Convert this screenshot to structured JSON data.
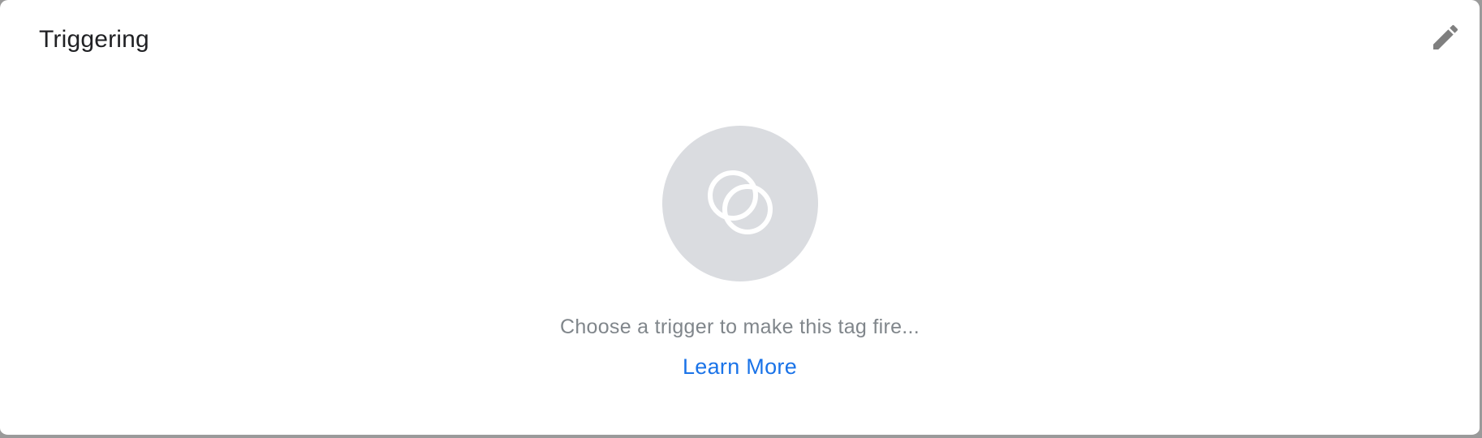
{
  "card": {
    "title": "Triggering",
    "edit_icon": "pencil-icon"
  },
  "empty_state": {
    "icon": "trigger-icon",
    "message": "Choose a trigger to make this tag fire...",
    "link_label": "Learn More"
  },
  "colors": {
    "title": "#202124",
    "message": "#80868b",
    "link": "#1a73e8",
    "icon_circle": "#dadce0",
    "icon_glyph": "#ffffff",
    "edit_icon": "#7f7f7f"
  }
}
